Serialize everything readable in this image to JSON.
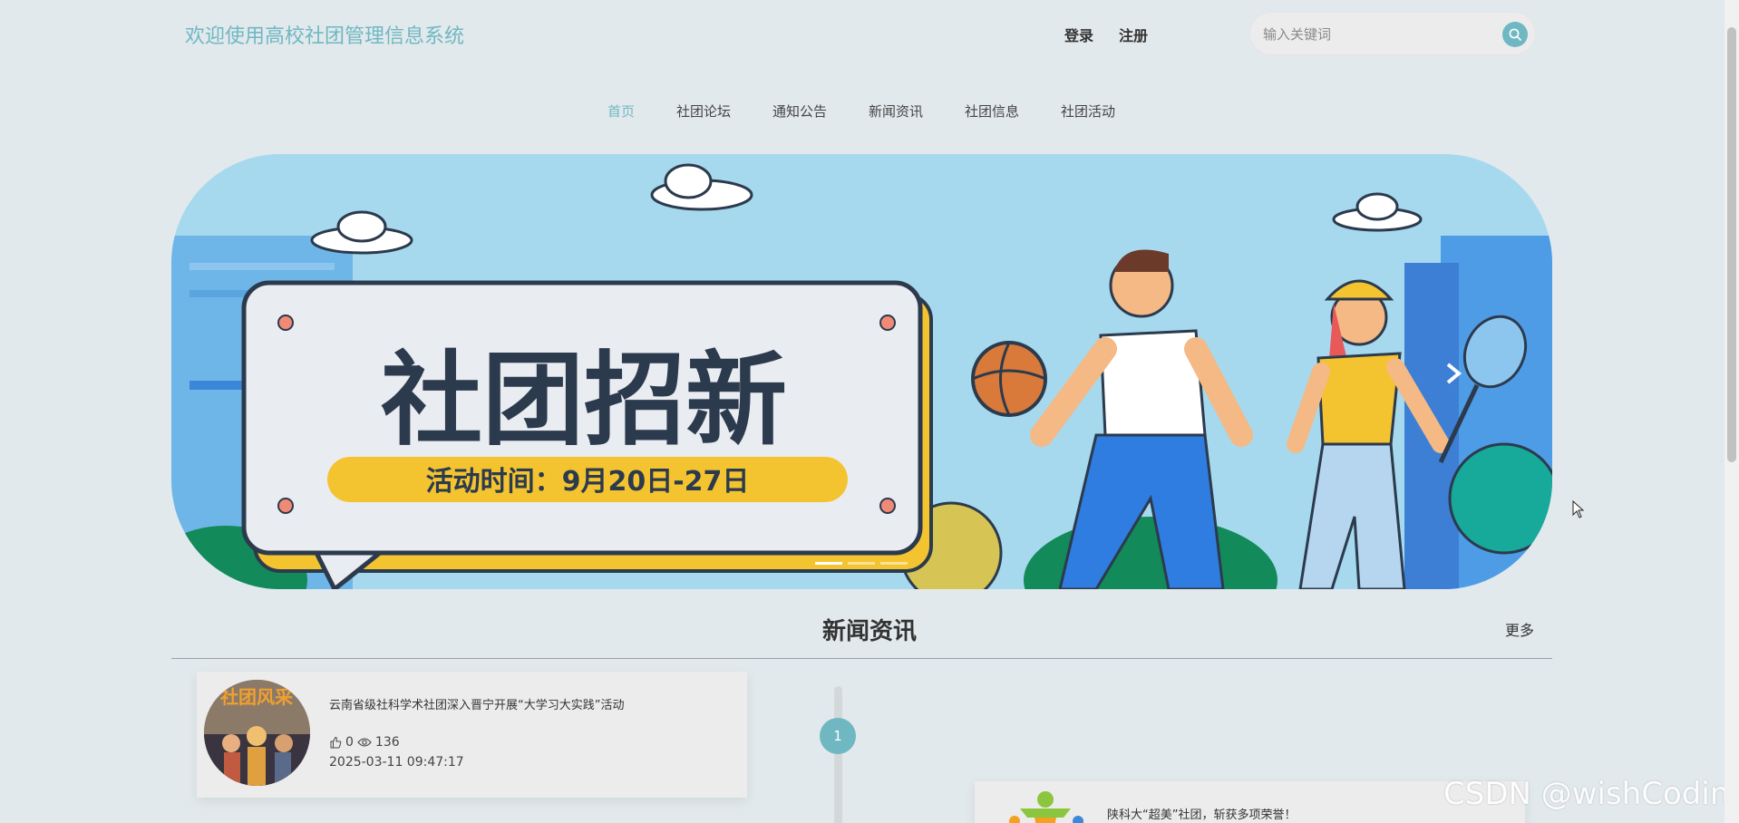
{
  "header": {
    "site_title": "欢迎使用高校社团管理信息系统",
    "login": "登录",
    "register": "注册",
    "search_placeholder": "输入关键词"
  },
  "nav": {
    "items": [
      "首页",
      "社团论坛",
      "通知公告",
      "新闻资讯",
      "社团信息",
      "社团活动"
    ],
    "active": "首页"
  },
  "banner": {
    "headline": "社团招新",
    "subtitle": "活动时间：9月20日-27日",
    "slide_count": 3,
    "active_slide": 1
  },
  "news_section": {
    "title": "新闻资讯",
    "more": "更多",
    "items": [
      {
        "title": "云南省级社科学术社团深入晋宁开展“大学习大实践”活动",
        "likes": "0",
        "views": "136",
        "date": "2025-03-11 09:47:17",
        "thumb_text": "社团风采"
      },
      {
        "title": "陕科大“超美”社团，斩获多项荣誉！"
      }
    ],
    "timeline_number": "1"
  },
  "watermark": "CSDN @wishCoding",
  "colors": {
    "accent": "#6fb8c2",
    "background": "#e2e9ec",
    "card": "#ececec"
  }
}
